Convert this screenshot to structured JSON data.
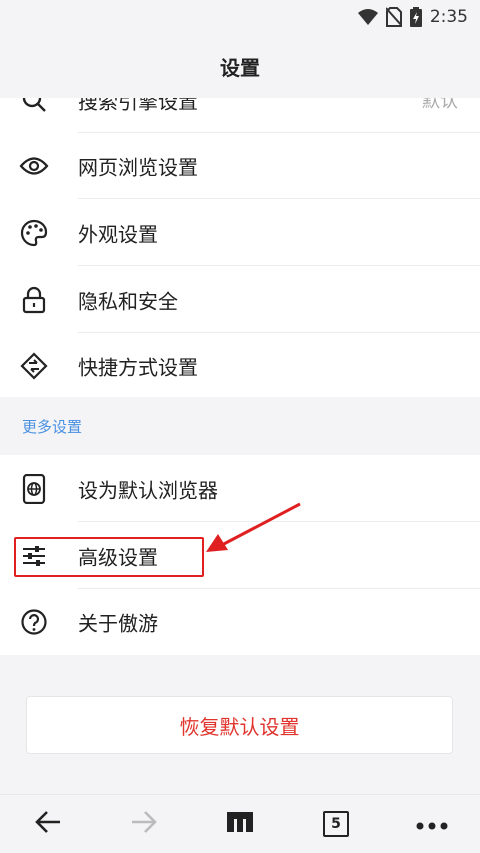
{
  "status_bar": {
    "time": "2:35"
  },
  "title": "设置",
  "rows_top": [
    {
      "label": "搜索引擎设置",
      "value": "默认",
      "icon": "search-icon"
    },
    {
      "label": "网页浏览设置",
      "icon": "eye-icon"
    },
    {
      "label": "外观设置",
      "icon": "palette-icon"
    },
    {
      "label": "隐私和安全",
      "icon": "lock-icon"
    },
    {
      "label": "快捷方式设置",
      "icon": "shortcut-icon"
    }
  ],
  "section_more": "更多设置",
  "rows_more": [
    {
      "label": "设为默认浏览器",
      "icon": "phone-globe-icon"
    },
    {
      "label": "高级设置",
      "icon": "sliders-icon"
    },
    {
      "label": "关于傲游",
      "icon": "help-icon"
    }
  ],
  "restore_label": "恢复默认设置",
  "bottom": {
    "tab_count": "5"
  },
  "colors": {
    "accent": "#4a90e2",
    "danger": "#e0342c",
    "highlight": "#e02020"
  }
}
